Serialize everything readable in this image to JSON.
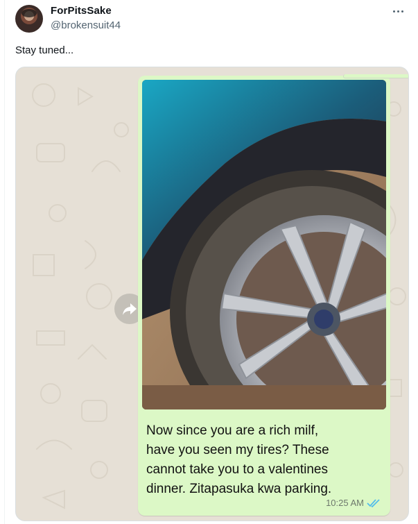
{
  "tweet": {
    "display_name": "ForPitsSake",
    "handle": "@brokensuit44",
    "text": "Stay tuned...",
    "more_icon": "more-horizontal-icon"
  },
  "chat": {
    "message_lines": [
      "Now since you are a rich milf,",
      "have you seen my tires? These",
      "cannot take you to a valentines",
      "dinner. Zitapasuka kwa parking."
    ],
    "timestamp": "10:25 AM",
    "status_icon": "double-check-read-icon",
    "forward_icon": "forward-arrow-icon",
    "bubble_color": "#dcf8c6",
    "read_tick_color": "#53bdeb"
  }
}
